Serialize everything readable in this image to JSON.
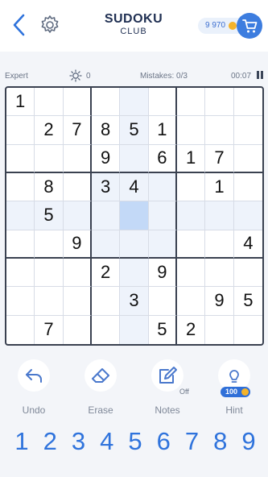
{
  "header": {
    "title": "SUDOKU",
    "subtitle": "CLUB",
    "coins": "9 970"
  },
  "status": {
    "level": "Expert",
    "score": "0",
    "mistakes": "Mistakes: 0/3",
    "timer": "00:07"
  },
  "board": {
    "cells": [
      [
        "1",
        "",
        "",
        "",
        "",
        "",
        "",
        "",
        ""
      ],
      [
        "",
        "2",
        "7",
        "8",
        "5",
        "1",
        "",
        "",
        ""
      ],
      [
        "",
        "",
        "",
        "9",
        "",
        "6",
        "1",
        "7",
        ""
      ],
      [
        "",
        "8",
        "",
        "3",
        "4",
        "",
        "",
        "1",
        ""
      ],
      [
        "",
        "5",
        "",
        "",
        "",
        "",
        "",
        "",
        ""
      ],
      [
        "",
        "",
        "9",
        "",
        "",
        "",
        "",
        "",
        "4"
      ],
      [
        "",
        "",
        "",
        "2",
        "",
        "9",
        "",
        "",
        ""
      ],
      [
        "",
        "",
        "",
        "",
        "3",
        "",
        "",
        "9",
        "5"
      ],
      [
        "",
        "7",
        "",
        "",
        "",
        "5",
        "2",
        "",
        ""
      ]
    ],
    "selected_cell": {
      "row": 5,
      "col": 5
    }
  },
  "tools": {
    "undo": "Undo",
    "erase": "Erase",
    "notes": "Notes",
    "notes_state": "Off",
    "hint": "Hint",
    "hint_cost": "100"
  },
  "numpad": [
    "1",
    "2",
    "3",
    "4",
    "5",
    "6",
    "7",
    "8",
    "9"
  ],
  "colors": {
    "accent": "#2f73dc",
    "grid_border": "#3a4150",
    "selected_cell": "#c3d9f7",
    "highlight_cell": "#eef3fb",
    "coin": "#f4b32a"
  }
}
